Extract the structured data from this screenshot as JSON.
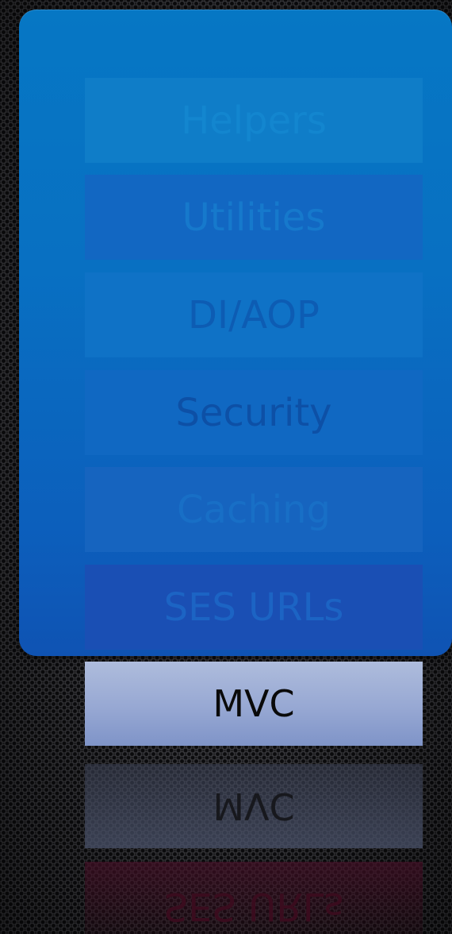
{
  "layers": [
    {
      "id": "helpers",
      "label": "Helpers"
    },
    {
      "id": "utilities",
      "label": "Utilities"
    },
    {
      "id": "di-aop",
      "label": "DI/AOP"
    },
    {
      "id": "security",
      "label": "Security"
    },
    {
      "id": "caching",
      "label": "Caching"
    },
    {
      "id": "ses-urls",
      "label": "SES URLs"
    }
  ],
  "base_layer": {
    "label": "MVC"
  },
  "reflections": {
    "mvc": "MVC",
    "ses_urls": "SES URLs"
  },
  "colors": {
    "panel": "#0870c2",
    "base_layer": "#97a8d3",
    "background": "#1b1b1d"
  }
}
